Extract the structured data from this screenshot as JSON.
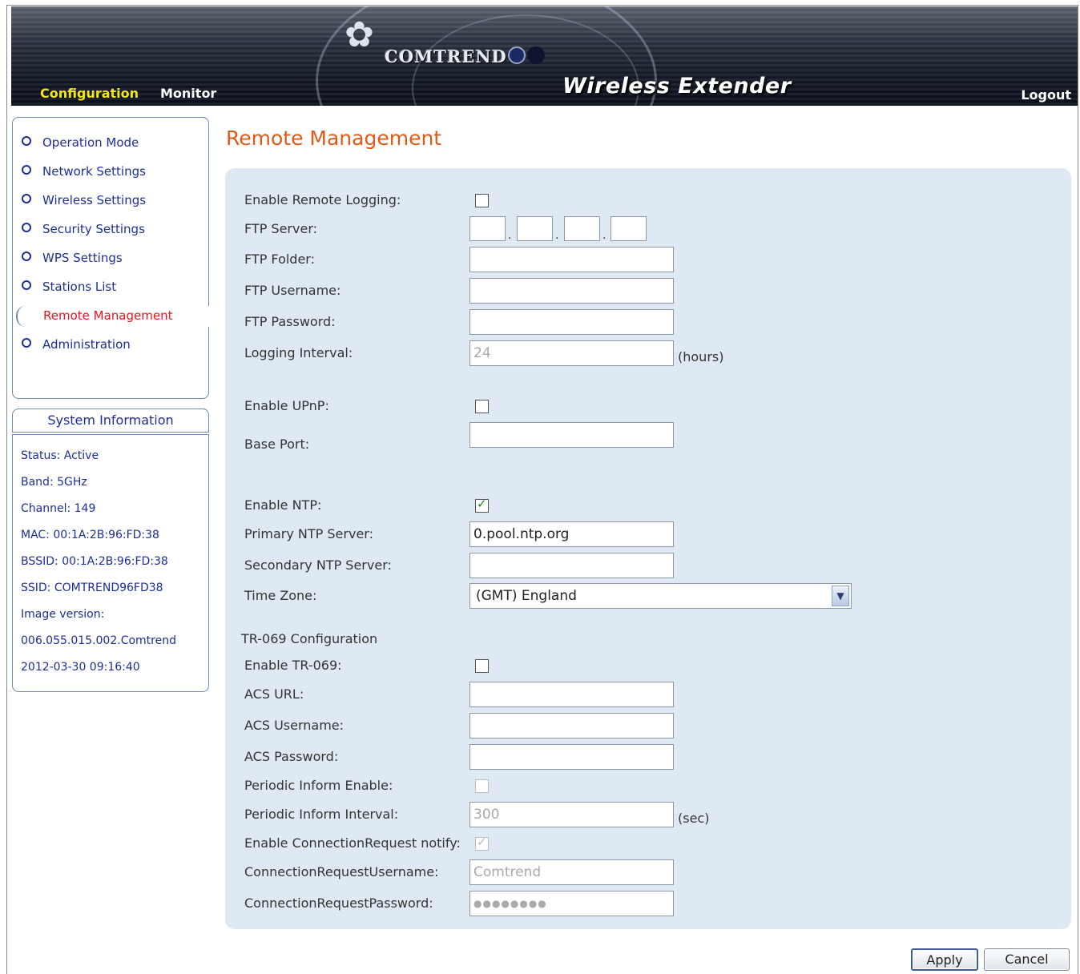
{
  "header": {
    "brand": "COMTREND",
    "product": "Wireless Extender",
    "nav_configuration": "Configuration",
    "nav_monitor": "Monitor",
    "logout": "Logout",
    "colors": {
      "active_nav": "#f5e61a",
      "brand_dot_1": "#1b2a63",
      "brand_dot_2": "#0e1330"
    }
  },
  "sidebar": {
    "items": [
      {
        "label": "Operation Mode"
      },
      {
        "label": "Network Settings"
      },
      {
        "label": "Wireless Settings"
      },
      {
        "label": "Security Settings"
      },
      {
        "label": "WPS Settings"
      },
      {
        "label": "Stations List"
      },
      {
        "label": "Remote Management",
        "active": true
      },
      {
        "label": "Administration"
      }
    ],
    "active_color": "#e8131b"
  },
  "system_info": {
    "title": "System Information",
    "lines": [
      "Status: Active",
      "Band: 5GHz",
      "Channel: 149",
      "MAC: 00:1A:2B:96:FD:38",
      "BSSID: 00:1A:2B:96:FD:38",
      "SSID: COMTREND96FD38",
      "Image version:",
      "006.055.015.002.Comtrend",
      "2012-03-30 09:16:40"
    ]
  },
  "main": {
    "title": "Remote Management",
    "logging": {
      "enable_label": "Enable Remote Logging:",
      "enable_checked": false,
      "ftp_server_label": "FTP Server:",
      "ftp_server_octets": [
        "",
        "",
        "",
        ""
      ],
      "ftp_folder_label": "FTP Folder:",
      "ftp_folder_value": "",
      "ftp_username_label": "FTP Username:",
      "ftp_username_value": "",
      "ftp_password_label": "FTP Password:",
      "ftp_password_value": "",
      "interval_label": "Logging Interval:",
      "interval_value": "24",
      "interval_unit": "(hours)"
    },
    "upnp": {
      "enable_label": "Enable UPnP:",
      "enable_checked": false,
      "base_port_label": "Base Port:",
      "base_port_value": ""
    },
    "ntp": {
      "enable_label": "Enable NTP:",
      "enable_checked": true,
      "primary_label": "Primary NTP Server:",
      "primary_value": "0.pool.ntp.org",
      "secondary_label": "Secondary NTP Server:",
      "secondary_value": "",
      "timezone_label": "Time Zone:",
      "timezone_value": "(GMT) England"
    },
    "tr069": {
      "section_label": "TR-069 Configuration",
      "enable_label": "Enable TR-069:",
      "enable_checked": false,
      "acs_url_label": "ACS URL:",
      "acs_url_value": "",
      "acs_username_label": "ACS Username:",
      "acs_username_value": "",
      "acs_password_label": "ACS Password:",
      "acs_password_value": "",
      "periodic_enable_label": "Periodic Inform Enable:",
      "periodic_enable_checked": false,
      "periodic_interval_label": "Periodic Inform Interval:",
      "periodic_interval_value": "300",
      "periodic_interval_unit": "(sec)",
      "conn_req_notify_label": "Enable ConnectionRequest notify:",
      "conn_req_notify_checked": true,
      "conn_req_username_label": "ConnectionRequestUsername:",
      "conn_req_username_value": "Comtrend",
      "conn_req_password_label": "ConnectionRequestPassword:",
      "conn_req_password_value": "●●●●●●●●"
    },
    "buttons": {
      "apply": "Apply",
      "cancel": "Cancel"
    }
  }
}
